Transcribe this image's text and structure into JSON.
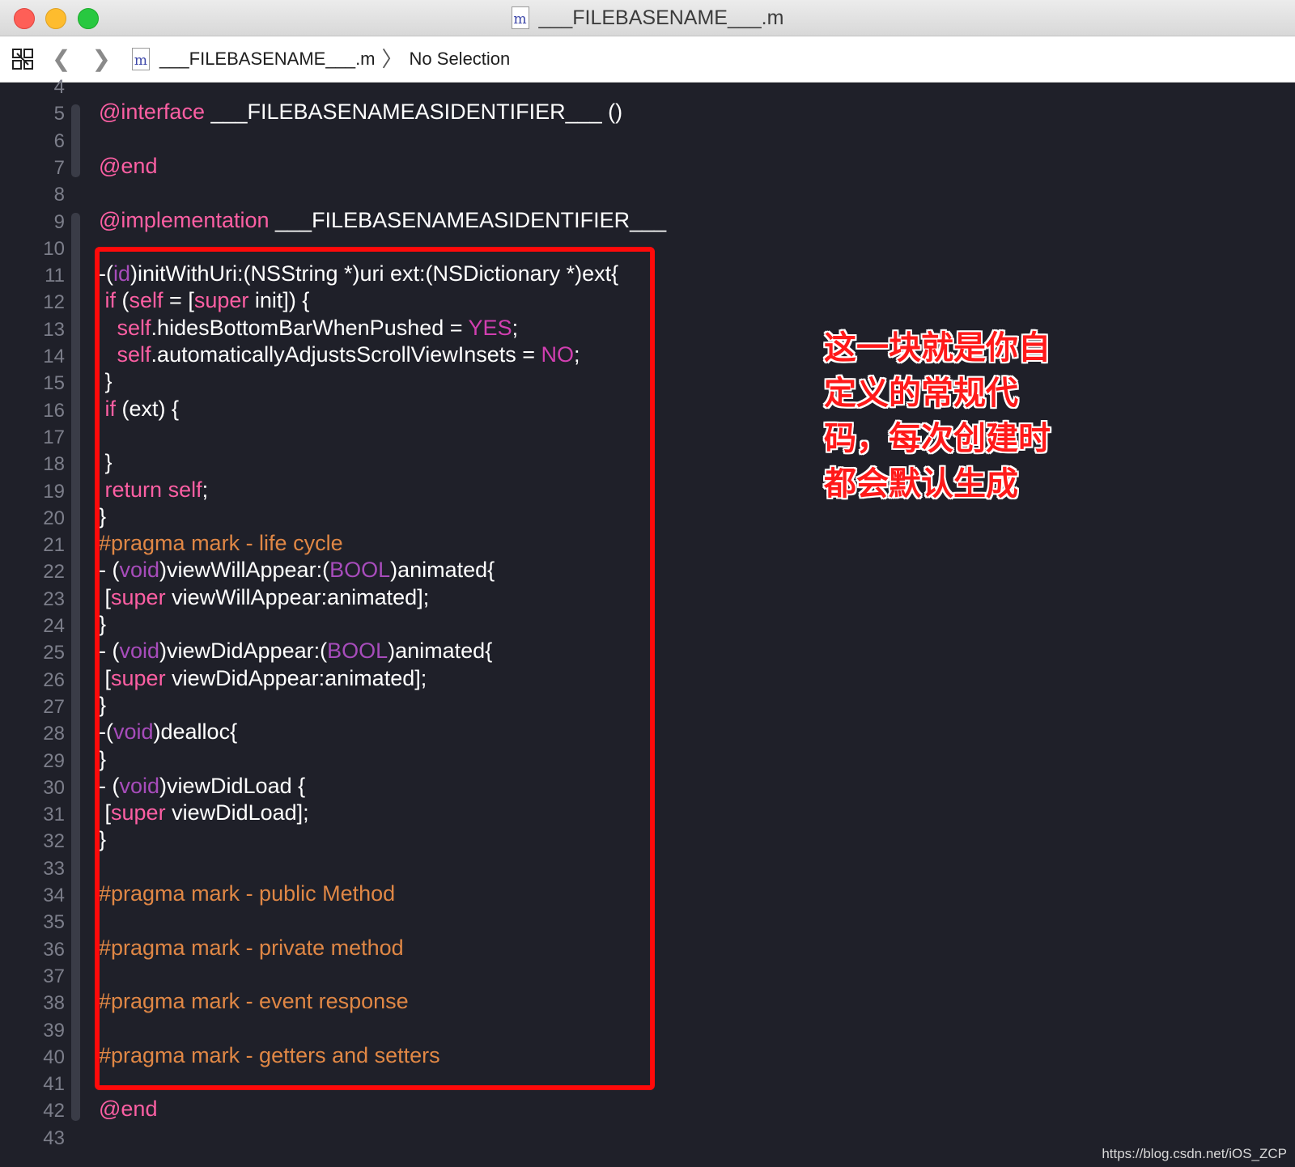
{
  "window": {
    "title": "___FILEBASENAME___.m",
    "file_icon_letter": "m"
  },
  "pathbar": {
    "file": "___FILEBASENAME___.m",
    "separator": "〉",
    "selection": "No Selection"
  },
  "editor": {
    "line_numbers": [
      "4",
      "5",
      "6",
      "7",
      "8",
      "9",
      "10",
      "11",
      "12",
      "13",
      "14",
      "15",
      "16",
      "17",
      "18",
      "19",
      "20",
      "21",
      "22",
      "23",
      "24",
      "25",
      "26",
      "27",
      "28",
      "29",
      "30",
      "31",
      "32",
      "33",
      "34",
      "35",
      "36",
      "37",
      "38",
      "39",
      "40",
      "41",
      "42",
      "43"
    ],
    "lines": [
      [],
      [
        {
          "t": "@interface",
          "k": "kw"
        },
        {
          "t": " ___FILEBASENAMEASIDENTIFIER___ ()",
          "k": ""
        }
      ],
      [],
      [
        {
          "t": "@end",
          "k": "kw"
        }
      ],
      [],
      [
        {
          "t": "@implementation",
          "k": "kw"
        },
        {
          "t": " ___FILEBASENAMEASIDENTIFIER___",
          "k": ""
        }
      ],
      [],
      [
        {
          "t": "-(",
          "k": ""
        },
        {
          "t": "id",
          "k": "ty"
        },
        {
          "t": ")initWithUri:(NSString *)uri ext:(NSDictionary *)ext{",
          "k": ""
        }
      ],
      [
        {
          "t": " ",
          "k": ""
        },
        {
          "t": "if",
          "k": "kw"
        },
        {
          "t": " (",
          "k": ""
        },
        {
          "t": "self",
          "k": "kw"
        },
        {
          "t": " = [",
          "k": ""
        },
        {
          "t": "super",
          "k": "kw"
        },
        {
          "t": " init]) {",
          "k": ""
        }
      ],
      [
        {
          "t": "   ",
          "k": ""
        },
        {
          "t": "self",
          "k": "kw"
        },
        {
          "t": ".hidesBottomBarWhenPushed = ",
          "k": ""
        },
        {
          "t": "YES",
          "k": "lit"
        },
        {
          "t": ";",
          "k": ""
        }
      ],
      [
        {
          "t": "   ",
          "k": ""
        },
        {
          "t": "self",
          "k": "kw"
        },
        {
          "t": ".automaticallyAdjustsScrollViewInsets = ",
          "k": ""
        },
        {
          "t": "NO",
          "k": "lit"
        },
        {
          "t": ";",
          "k": ""
        }
      ],
      [
        {
          "t": " }",
          "k": ""
        }
      ],
      [
        {
          "t": " ",
          "k": ""
        },
        {
          "t": "if",
          "k": "kw"
        },
        {
          "t": " (ext) {",
          "k": ""
        }
      ],
      [],
      [
        {
          "t": " }",
          "k": ""
        }
      ],
      [
        {
          "t": " ",
          "k": ""
        },
        {
          "t": "return",
          "k": "kw"
        },
        {
          "t": " ",
          "k": ""
        },
        {
          "t": "self",
          "k": "kw"
        },
        {
          "t": ";",
          "k": ""
        }
      ],
      [
        {
          "t": "}",
          "k": ""
        }
      ],
      [
        {
          "t": "#pragma mark - life cycle",
          "k": "pg"
        }
      ],
      [
        {
          "t": "- (",
          "k": ""
        },
        {
          "t": "void",
          "k": "ty"
        },
        {
          "t": ")viewWillAppear:(",
          "k": ""
        },
        {
          "t": "BOOL",
          "k": "ty"
        },
        {
          "t": ")animated{",
          "k": ""
        }
      ],
      [
        {
          "t": " [",
          "k": ""
        },
        {
          "t": "super",
          "k": "kw"
        },
        {
          "t": " viewWillAppear:animated];",
          "k": ""
        }
      ],
      [
        {
          "t": "}",
          "k": ""
        }
      ],
      [
        {
          "t": "- (",
          "k": ""
        },
        {
          "t": "void",
          "k": "ty"
        },
        {
          "t": ")viewDidAppear:(",
          "k": ""
        },
        {
          "t": "BOOL",
          "k": "ty"
        },
        {
          "t": ")animated{",
          "k": ""
        }
      ],
      [
        {
          "t": " [",
          "k": ""
        },
        {
          "t": "super",
          "k": "kw"
        },
        {
          "t": " viewDidAppear:animated];",
          "k": ""
        }
      ],
      [
        {
          "t": "}",
          "k": ""
        }
      ],
      [
        {
          "t": "-(",
          "k": ""
        },
        {
          "t": "void",
          "k": "ty"
        },
        {
          "t": ")dealloc{",
          "k": ""
        }
      ],
      [
        {
          "t": "}",
          "k": ""
        }
      ],
      [
        {
          "t": "- (",
          "k": ""
        },
        {
          "t": "void",
          "k": "ty"
        },
        {
          "t": ")viewDidLoad {",
          "k": ""
        }
      ],
      [
        {
          "t": " [",
          "k": ""
        },
        {
          "t": "super",
          "k": "kw"
        },
        {
          "t": " viewDidLoad];",
          "k": ""
        }
      ],
      [
        {
          "t": "}",
          "k": ""
        }
      ],
      [],
      [
        {
          "t": "#pragma mark - public Method",
          "k": "pg"
        }
      ],
      [],
      [
        {
          "t": "#pragma mark - private method",
          "k": "pg"
        }
      ],
      [],
      [
        {
          "t": "#pragma mark - event response",
          "k": "pg"
        }
      ],
      [],
      [
        {
          "t": "#pragma mark - getters and setters",
          "k": "pg"
        }
      ],
      [],
      [
        {
          "t": "@end",
          "k": "kw"
        }
      ],
      []
    ]
  },
  "annotation": {
    "lines": [
      "这一块就是你自",
      "定义的常规代",
      "码，每次创建时",
      "都会默认生成"
    ]
  },
  "watermark": "https://blog.csdn.net/iOS_ZCP",
  "colors": {
    "editor_bg": "#1f2029",
    "keyword": "#fc5fa3",
    "pragma": "#e08745",
    "highlight_box": "#ff0a0a"
  }
}
